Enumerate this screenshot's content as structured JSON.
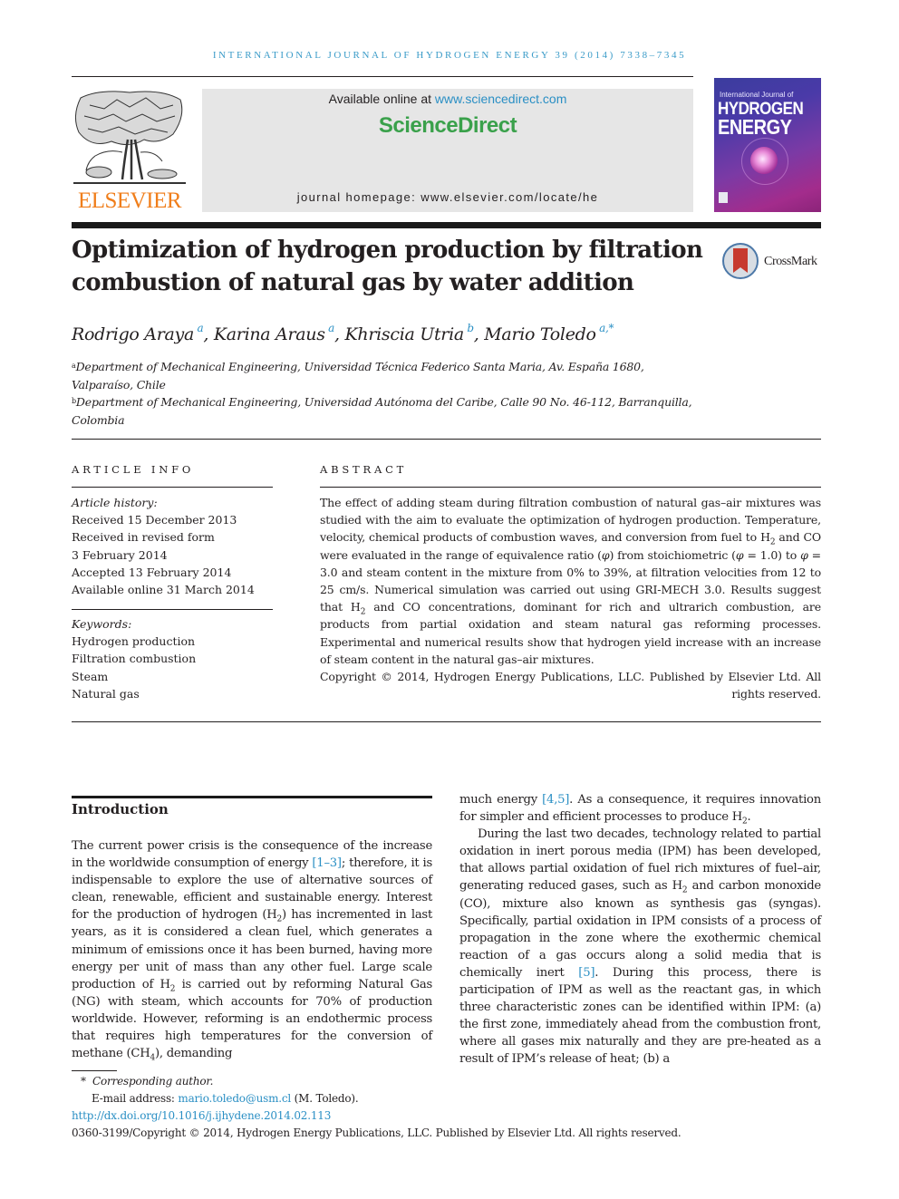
{
  "running_head": "INTERNATIONAL JOURNAL OF HYDROGEN ENERGY 39 (2014) 7338–7345",
  "header": {
    "publisher_logo_text": "ELSEVIER",
    "available_prefix": "Available online at ",
    "available_link": "www.sciencedirect.com",
    "brand": "ScienceDirect",
    "homepage_prefix": "journal homepage: ",
    "homepage_url": "www.elsevier.com/locate/he",
    "cover": {
      "line1": "International Journal of",
      "line2": "HYDROGEN",
      "line3": "ENERGY"
    },
    "colors": {
      "elsevier_orange": "#f07e1b",
      "sciencedirect_green": "#3aa14b",
      "link_blue": "#2a8fc4"
    }
  },
  "article": {
    "title": "Optimization of hydrogen production by filtration combustion of natural gas by water addition",
    "crossmark_label": "CrossMark",
    "authors": [
      {
        "name": "Rodrigo Araya",
        "sup": "a"
      },
      {
        "name": "Karina Araus",
        "sup": "a"
      },
      {
        "name": "Khriscia Utria",
        "sup": "b"
      },
      {
        "name": "Mario Toledo",
        "sup": "a,*"
      }
    ],
    "affiliations": [
      {
        "mark": "a",
        "text": "Department of Mechanical Engineering, Universidad Técnica Federico Santa Maria, Av. España 1680, Valparaíso, Chile"
      },
      {
        "mark": "b",
        "text": "Department of Mechanical Engineering, Universidad Autónoma del Caribe, Calle 90 No. 46-112, Barranquilla, Colombia"
      }
    ]
  },
  "article_info": {
    "heading": "ARTICLE INFO",
    "history_label": "Article history:",
    "history": [
      "Received 15 December 2013",
      "Received in revised form",
      "3 February 2014",
      "Accepted 13 February 2014",
      "Available online 31 March 2014"
    ],
    "keywords_label": "Keywords:",
    "keywords": [
      "Hydrogen production",
      "Filtration combustion",
      "Steam",
      "Natural gas"
    ]
  },
  "abstract": {
    "heading": "ABSTRACT",
    "p1": "The effect of adding steam during filtration combustion of natural gas–air mixtures was studied with the aim to evaluate the optimization of hydrogen production. Temperature, velocity, chemical products of combustion waves, and conversion from fuel to ",
    "p2": " and CO were evaluated in the range of equivalence ratio (",
    "p3": ") from stoichiometric (",
    "p4": " = 1.0) to ",
    "p5": " = 3.0 and steam content in the mixture from 0% to 39%, at filtration velocities from 12 to 25 cm/s. Numerical simulation was carried out using GRI-MECH 3.0. Results suggest that ",
    "p6": " and CO concentrations, dominant for rich and ultrarich combustion, are products from partial oxidation and steam natural gas reforming processes. Experimental and numerical results show that hydrogen yield increase with an increase of steam content in the natural gas–air mixtures.",
    "phi": "φ",
    "h": "H",
    "two": "2",
    "copyright": "Copyright © 2014, Hydrogen Energy Publications, LLC. Published by Elsevier Ltd. All rights reserved."
  },
  "introduction": {
    "heading": "Introduction",
    "left": {
      "a": "The current power crisis is the consequence of the increase in the worldwide consumption of energy ",
      "ref1": "[1–3]",
      "b": "; therefore, it is indispensable to explore the use of alternative sources of clean, renewable, efficient and sustainable energy. Interest for the production of hydrogen (H",
      "c": ") has incremented in last years, as it is considered a clean fuel, which generates a minimum of emissions once it has been burned, having more energy per unit of mass than any other fuel. Large scale production of H",
      "d": " is carried out by reforming Natural Gas (NG) with steam, which accounts for 70% of production worldwide. However, reforming is an endothermic process that requires high temperatures for the conversion of methane (CH",
      "sub4": "4",
      "e": "), demanding"
    },
    "right": {
      "a": "much energy ",
      "ref2": "[4,5]",
      "b": ". As a consequence, it requires innovation for simpler and efficient processes to produce H",
      "c": ".",
      "p2a": "During the last two decades, technology related to partial oxidation in inert porous media (IPM) has been developed, that allows partial oxidation of fuel rich mixtures of fuel–air, generating reduced gases, such as H",
      "p2b": " and carbon monoxide (CO), mixture also known as synthesis gas (syngas). Specifically, partial oxidation in IPM consists of a process of propagation in the zone where the exothermic chemical reaction of a gas occurs along a solid media that is chemically inert ",
      "ref3": "[5]",
      "p2c": ". During this process, there is participation of IPM as well as the reactant gas, in which three characteristic zones can be identified within IPM: (a) the first zone, immediately ahead from the combustion front, where all gases mix naturally and they are pre-heated as a result of IPM’s release of heat; (b) a"
    }
  },
  "footnotes": {
    "star": "*",
    "corresponding": "Corresponding author.",
    "email_label": "E-mail address: ",
    "email": "mario.toledo@usm.cl",
    "email_suffix": " (M. Toledo).",
    "doi": "http://dx.doi.org/10.1016/j.ijhydene.2014.02.113",
    "issn_copyright": "0360-3199/Copyright © 2014, Hydrogen Energy Publications, LLC. Published by Elsevier Ltd. All rights reserved."
  }
}
